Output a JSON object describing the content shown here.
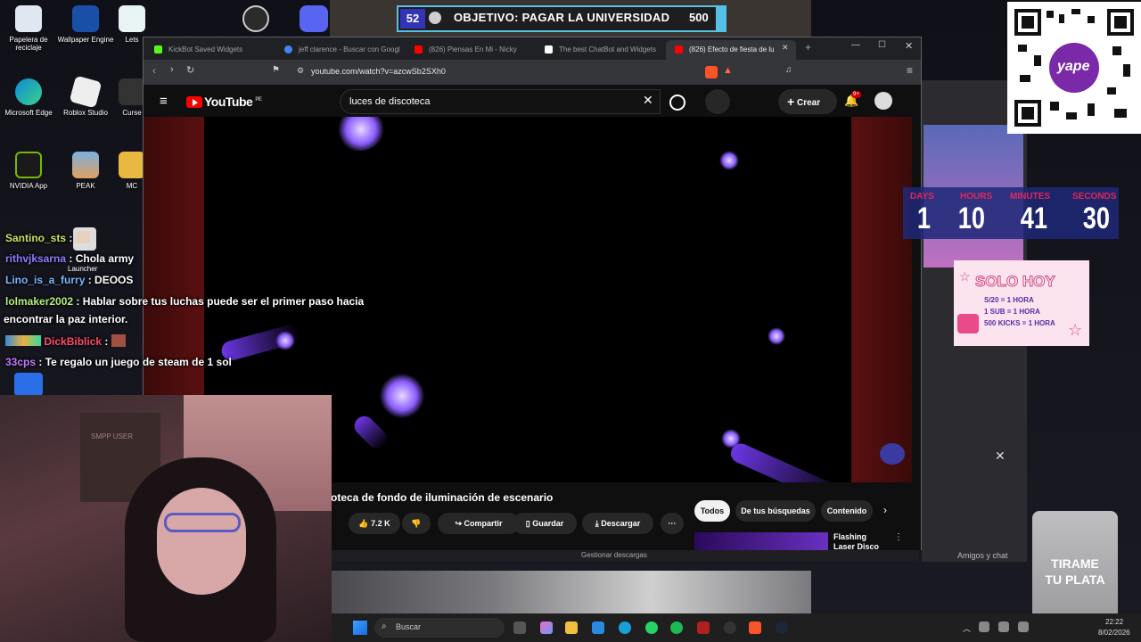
{
  "desktop": {
    "icons": [
      {
        "label": "Papelera de reciclaje"
      },
      {
        "label": "Wallpaper Engine"
      },
      {
        "label": "Lets"
      },
      {
        "label": "Microsoft Edge"
      },
      {
        "label": "Roblox Studio"
      },
      {
        "label": "Curse"
      },
      {
        "label": "NVIDIA App"
      },
      {
        "label": "PEAK"
      },
      {
        "label": "MC"
      }
    ],
    "launcher_label": "Launcher"
  },
  "goal": {
    "count": "52",
    "text": "OBJETIVO: PAGAR LA UNIVERSIDAD",
    "amount": "500"
  },
  "browser": {
    "tabs": [
      {
        "label": "KickBot Saved Widgets",
        "color": "#53fc18"
      },
      {
        "label": "jeff clarence - Buscar con Googl",
        "color": "#4285f4"
      },
      {
        "label": "(826) Piensas En Mi - Nicky",
        "color": "#ff0000"
      },
      {
        "label": "The best ChatBot and Widgets",
        "color": "#ffffff"
      },
      {
        "label": "(826) Efecto de fiesta de lu",
        "color": "#ff0000"
      }
    ],
    "url": "youtube.com/watch?v=azcwSb2SXh0"
  },
  "youtube": {
    "logo": "YouTube",
    "region": "PE",
    "search_query": "luces de discoteca",
    "create_label": "Crear",
    "notif_badge": "9+",
    "video_title": "oteca de fondo de iluminación de escenario",
    "likes": "7.2 K",
    "share_label": "Compartir",
    "save_label": "Guardar",
    "download_label": "Descargar",
    "chips": [
      "Todos",
      "De tus búsquedas",
      "Contenido"
    ],
    "suggested_title": "Flashing Laser Disco"
  },
  "download_bar": "Gestionar descargas",
  "chat": [
    {
      "user": "Santino_sts",
      "color": "#c8e05a",
      "msg": ""
    },
    {
      "user": "rithvjksarna",
      "color": "#8a7cff",
      "msg": "Chola army"
    },
    {
      "user": "Lino_is_a_furry",
      "color": "#7ab8ff",
      "msg": "DEOOS"
    },
    {
      "user": "lolmaker2002",
      "color": "#b0f07a",
      "msg": "Hablar sobre tus luchas puede ser el primer paso hacia"
    },
    {
      "user": "",
      "color": "#ffffff",
      "msg": "encontrar la paz interior."
    },
    {
      "user": "DickBiblick",
      "color": "#ff4a6a",
      "msg": ""
    },
    {
      "user": "33cps",
      "color": "#c07aff",
      "msg": "Te regalo un juego de steam de 1 sol"
    }
  ],
  "webcam": {
    "poster_text": "SMPP USER"
  },
  "timer": {
    "labels": [
      "DAYS",
      "HOURS",
      "MINUTES",
      "SECONDS"
    ],
    "values": [
      "1",
      "10",
      "41",
      "30"
    ]
  },
  "promo": {
    "title": "SOLO HOY",
    "lines": [
      "S/20 = 1 HORA",
      "1 SUB = 1 HORA",
      "500 KICKS = 1 HORA"
    ]
  },
  "qr_label": "yape",
  "side_panel": {
    "friends_label": "Amigos y chat"
  },
  "tip_jar": "TIRAME TU PLATA",
  "taskbar": {
    "search_placeholder": "Buscar",
    "time": "22:22",
    "date": "8/02/2026"
  }
}
